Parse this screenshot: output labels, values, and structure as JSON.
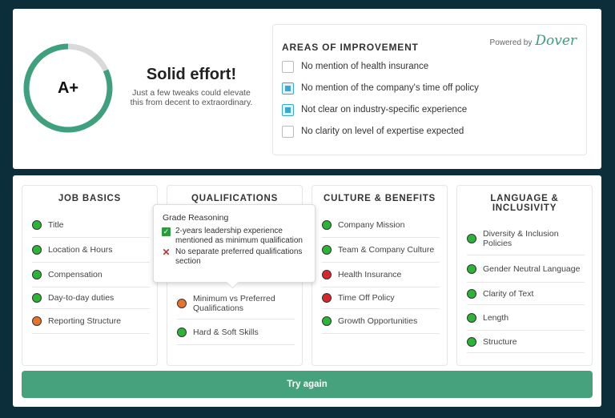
{
  "summary": {
    "grade": "A+",
    "grade_fraction": 0.82,
    "headline": "Solid effort!",
    "subline": "Just a few tweaks could elevate this from decent to extraordinary."
  },
  "areas": {
    "title": "AREAS OF IMPROVEMENT",
    "powered_by": "Powered by",
    "brand": "Dover",
    "items": [
      {
        "label": "No mention of health insurance",
        "checked": false
      },
      {
        "label": "No mention of the company's time off policy",
        "checked": true
      },
      {
        "label": "Not clear on industry-specific experience",
        "checked": true
      },
      {
        "label": "No clarity on level of expertise expected",
        "checked": false
      }
    ]
  },
  "columns": [
    {
      "title": "JOB BASICS",
      "items": [
        {
          "label": "Title",
          "status": "green"
        },
        {
          "label": "Location & Hours",
          "status": "green"
        },
        {
          "label": "Compensation",
          "status": "green"
        },
        {
          "label": "Day-to-day duties",
          "status": "green"
        },
        {
          "label": "Reporting Structure",
          "status": "orange"
        }
      ]
    },
    {
      "title": "QUALIFICATIONS",
      "items": [
        {
          "label": "Minimum vs Preferred Qualifications",
          "status": "orange"
        },
        {
          "label": "Hard & Soft Skills",
          "status": "green"
        }
      ]
    },
    {
      "title": "CULTURE & BENEFITS",
      "items": [
        {
          "label": "Company Mission",
          "status": "green"
        },
        {
          "label": "Team & Company Culture",
          "status": "green"
        },
        {
          "label": "Health Insurance",
          "status": "red"
        },
        {
          "label": "Time Off Policy",
          "status": "red"
        },
        {
          "label": "Growth Opportunities",
          "status": "green"
        }
      ]
    },
    {
      "title": "LANGUAGE & INCLUSIVITY",
      "items": [
        {
          "label": "Diversity & Inclusion Policies",
          "status": "green"
        },
        {
          "label": "Gender Neutral Language",
          "status": "green"
        },
        {
          "label": "Clarity of Text",
          "status": "green"
        },
        {
          "label": "Length",
          "status": "green"
        },
        {
          "label": "Structure",
          "status": "green"
        }
      ]
    }
  ],
  "tooltip": {
    "title": "Grade Reasoning",
    "items": [
      {
        "label": "2-years leadership experience mentioned as minimum qualification",
        "icon": "check-icon"
      },
      {
        "label": "No separate preferred qualifications section",
        "icon": "cross-icon"
      }
    ]
  },
  "try_again": "Try again",
  "colors": {
    "accent": "#45a27c",
    "ring": "#3fa07e",
    "ring_track": "#d9d9d9",
    "green": "#2bb537",
    "orange": "#e8742c",
    "red": "#d7262c",
    "background": "#0b2e3a"
  }
}
